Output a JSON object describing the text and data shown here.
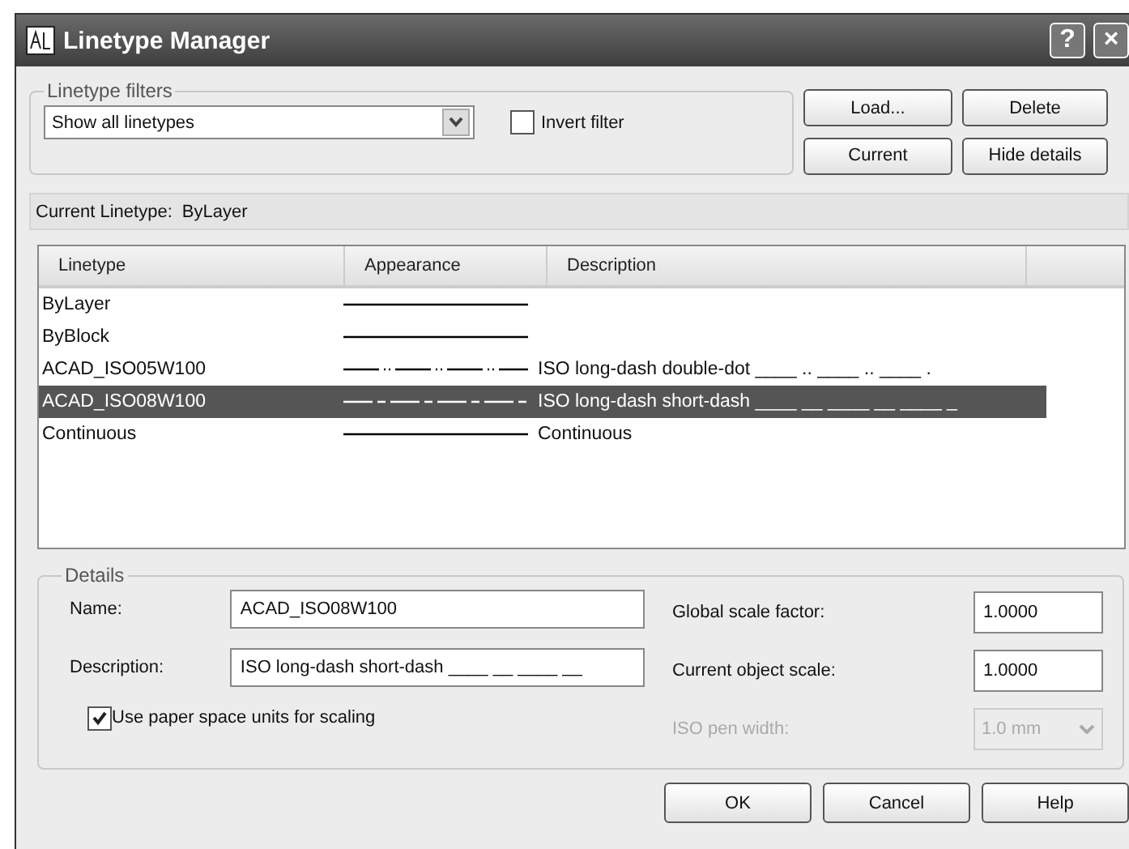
{
  "window": {
    "title": "Linetype Manager",
    "help_button": "?",
    "close_button": "×"
  },
  "filters": {
    "legend": "Linetype filters",
    "dropdown_value": "Show all linetypes",
    "invert_label": "Invert filter",
    "invert_checked": false
  },
  "side_buttons": [
    "Load...",
    "Delete",
    "Current",
    "Hide details"
  ],
  "current_linetype": {
    "label": "Current Linetype:",
    "value": "ByLayer"
  },
  "table": {
    "columns": [
      "Linetype",
      "Appearance",
      "Description"
    ],
    "rows": [
      {
        "linetype": "ByLayer",
        "kind": "solid",
        "description": "",
        "selected": false
      },
      {
        "linetype": "ByBlock",
        "kind": "solid",
        "description": "",
        "selected": false
      },
      {
        "linetype": "ACAD_ISO05W100",
        "kind": "doubledot",
        "description": "ISO long-dash double-dot ____ .. ____ .. ____ .",
        "selected": false
      },
      {
        "linetype": "ACAD_ISO08W100",
        "kind": "shortdash",
        "description": "ISO long-dash short-dash ____ __ ____ __ ____ _",
        "selected": true
      },
      {
        "linetype": "Continuous",
        "kind": "solid",
        "description": "Continuous",
        "selected": false
      }
    ]
  },
  "details": {
    "legend": "Details",
    "name_label": "Name:",
    "name_value": "ACAD_ISO08W100",
    "description_label": "Description:",
    "description_value": "ISO long-dash short-dash ____ __ ____ __",
    "paper_space_label": "Use paper space units for scaling",
    "paper_space_checked": true,
    "global_scale_label": "Global scale factor:",
    "global_scale_value": "1.0000",
    "object_scale_label": "Current object scale:",
    "object_scale_value": "1.0000",
    "pen_width_label": "ISO pen width:",
    "pen_width_value": "1.0 mm",
    "pen_width_disabled": true
  },
  "buttons": [
    "OK",
    "Cancel",
    "Help"
  ]
}
